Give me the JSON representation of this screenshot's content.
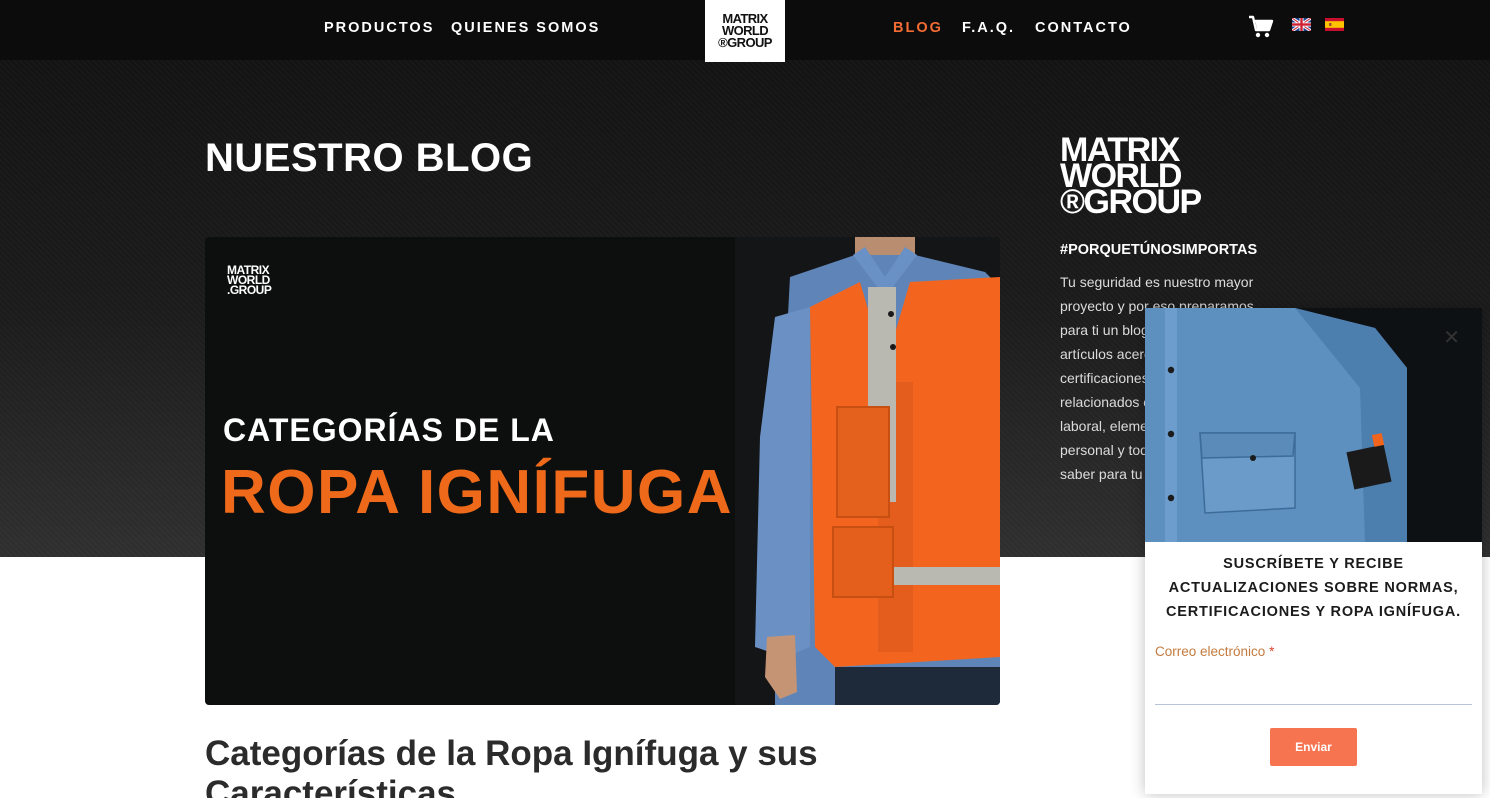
{
  "nav": {
    "left_links": [
      "PRODUCTOS",
      "QUIENES SOMOS"
    ],
    "right_links": [
      "BLOG",
      "F.A.Q.",
      "CONTACTO"
    ],
    "active_link": "BLOG",
    "logo_lines": [
      "MATRIX",
      "WORLD",
      "®GROUP"
    ],
    "cart_icon": "shopping-cart-icon",
    "flags": [
      "uk-flag-icon",
      "spain-flag-icon"
    ]
  },
  "page": {
    "title": "NUESTRO BLOG"
  },
  "featured": {
    "logo_lines": [
      "MATRIX",
      "WORLD",
      ".GROUP"
    ],
    "line1": "CATEGORÍAS DE LA",
    "line2": "ROPA IGNÍFUGA"
  },
  "article": {
    "title": "Categorías de la Ropa Ignífuga y sus Características"
  },
  "sidebar": {
    "logo_lines": [
      "MATRIX",
      "WORLD",
      "®GROUP"
    ],
    "hashtag": "#PORQUETÚNOSIMPORTAS",
    "text": "Tu seguridad es nuestro mayor proyecto y por eso preparamos para ti un blog con información y artículos acerca de normas, certificaciones y temas relacionados con la seguridad laboral, elementos de protección personal y todo lo que debes saber para tu protección."
  },
  "popup": {
    "title_lines": [
      "SUSCRÍBETE Y RECIBE",
      "ACTUALIZACIONES SOBRE NORMAS,",
      "CERTIFICACIONES Y ROPA IGNÍFUGA."
    ],
    "email_label": "Correo electrónico",
    "required_mark": "*",
    "submit_label": "Enviar",
    "close_icon": "close-icon"
  },
  "colors": {
    "accent": "#f36c33",
    "headline_orange": "#ee6a1a",
    "button": "#f6744f",
    "nav_bg": "#0c0c0c"
  }
}
